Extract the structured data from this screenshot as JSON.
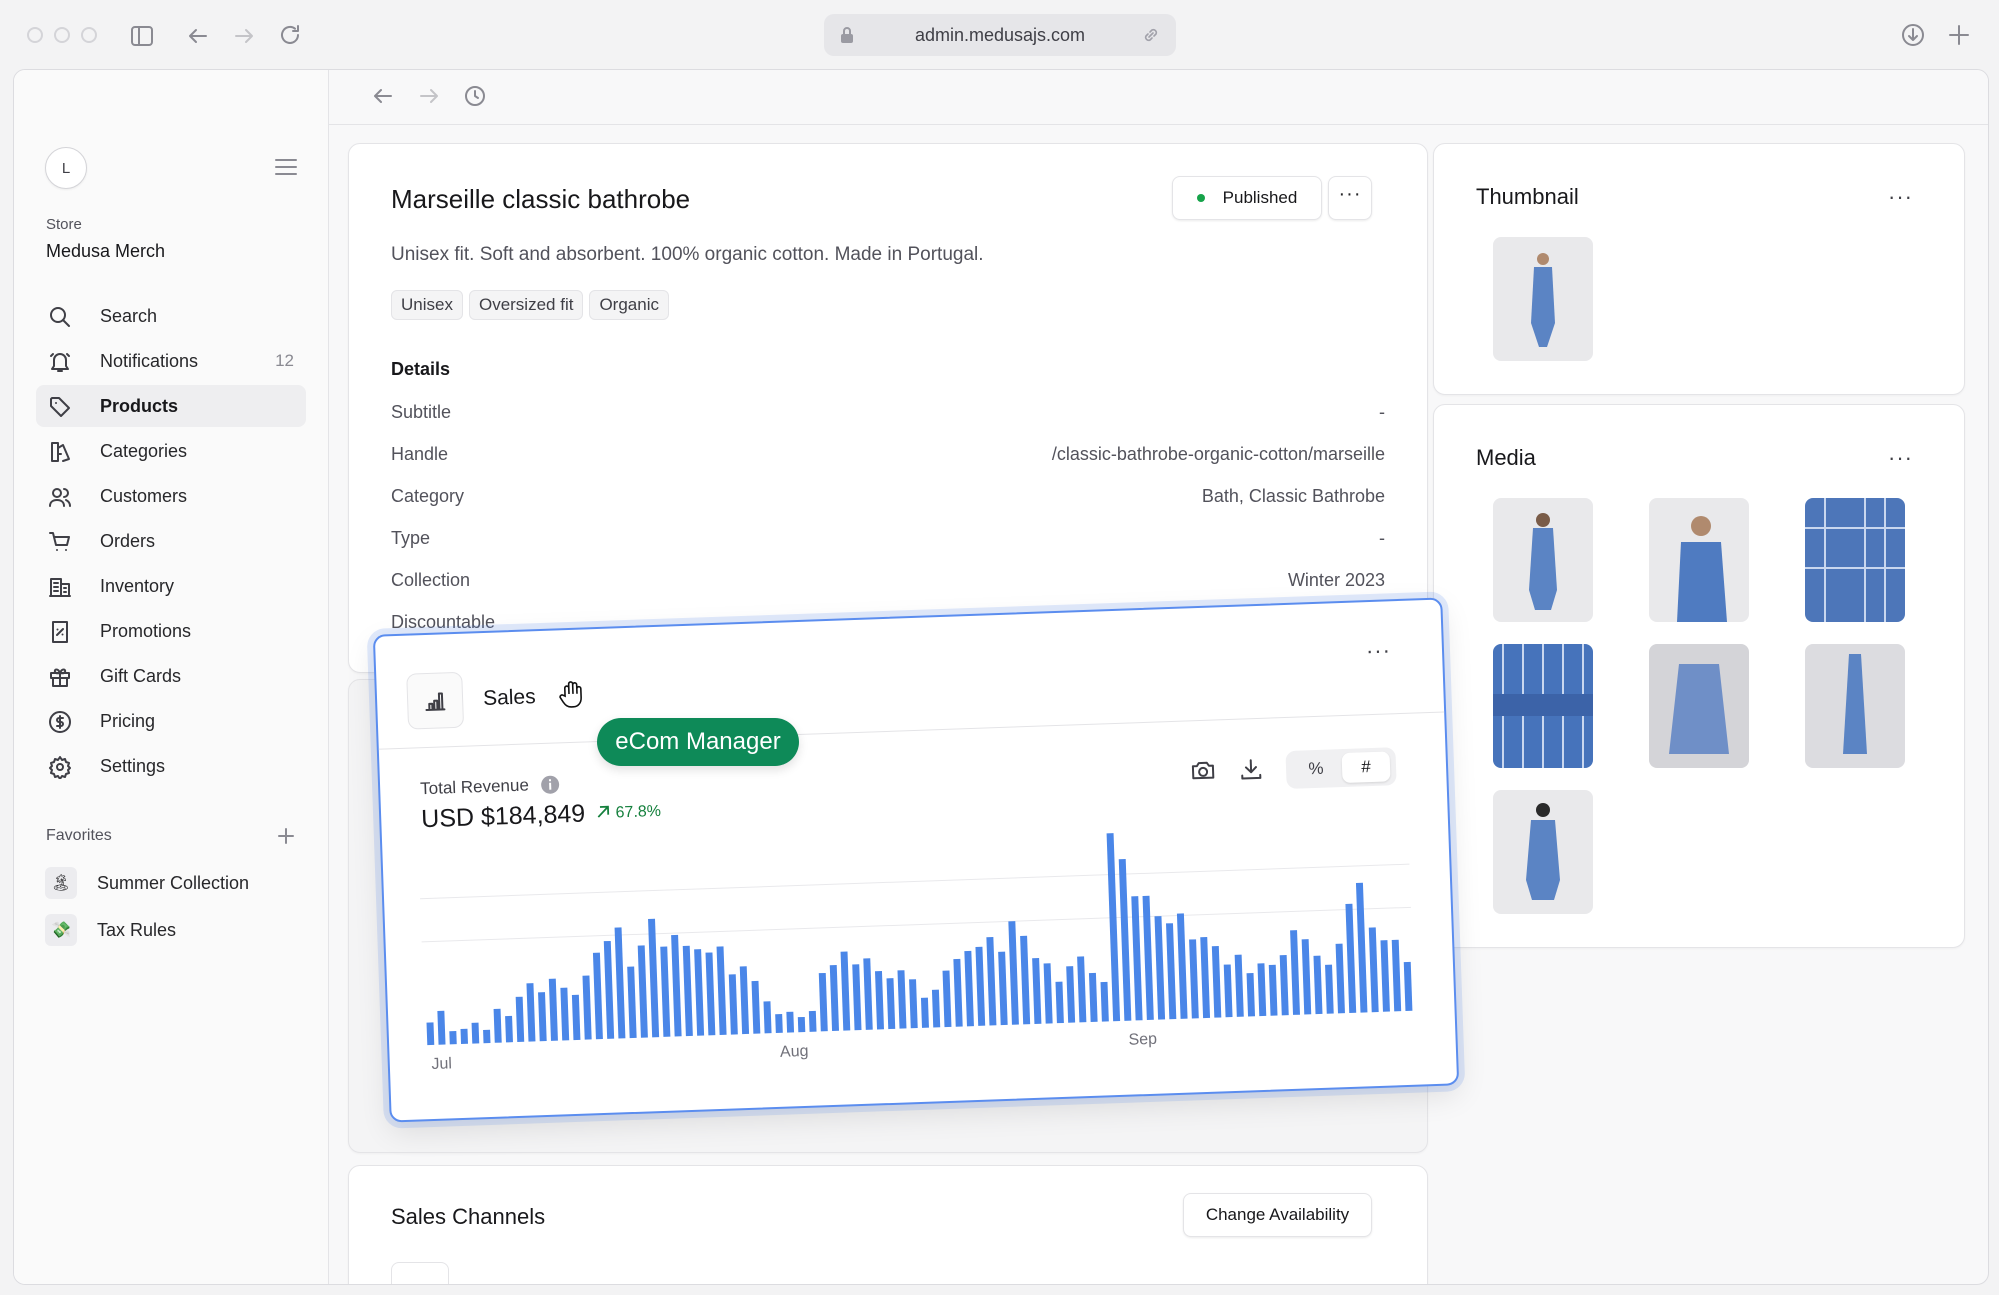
{
  "browser": {
    "url": "admin.medusajs.com"
  },
  "sidebar": {
    "avatar_initial": "L",
    "store_label": "Store",
    "store_name": "Medusa Merch",
    "items": [
      {
        "label": "Search",
        "icon": "search-icon"
      },
      {
        "label": "Notifications",
        "icon": "bell-icon",
        "count": "12"
      },
      {
        "label": "Products",
        "icon": "tag-icon",
        "active": true
      },
      {
        "label": "Categories",
        "icon": "categories-icon"
      },
      {
        "label": "Customers",
        "icon": "users-icon"
      },
      {
        "label": "Orders",
        "icon": "cart-icon"
      },
      {
        "label": "Inventory",
        "icon": "building-icon"
      },
      {
        "label": "Promotions",
        "icon": "receipt-percent-icon"
      },
      {
        "label": "Gift Cards",
        "icon": "gift-icon"
      },
      {
        "label": "Pricing",
        "icon": "currency-icon"
      },
      {
        "label": "Settings",
        "icon": "gear-icon"
      }
    ],
    "favorites_label": "Favorites",
    "favorites": [
      {
        "label": "Summer Collection",
        "icon": "palm-tree-icon"
      },
      {
        "label": "Tax Rules",
        "icon": "money-icon"
      }
    ]
  },
  "product": {
    "title": "Marseille classic bathrobe",
    "status": "Published",
    "status_color": "#16a34a",
    "description": "Unisex fit. Soft and absorbent. 100% organic cotton. Made in Portugal.",
    "tags": [
      "Unisex",
      "Oversized fit",
      "Organic"
    ],
    "details_heading": "Details",
    "details": [
      {
        "key": "Subtitle",
        "value": "-"
      },
      {
        "key": "Handle",
        "value": "/classic-bathrobe-organic-cotton/marseille"
      },
      {
        "key": "Category",
        "value": "Bath, Classic Bathrobe"
      },
      {
        "key": "Type",
        "value": "-"
      },
      {
        "key": "Collection",
        "value": "Winter 2023"
      },
      {
        "key": "Discountable",
        "value": ""
      }
    ]
  },
  "thumbnail": {
    "heading": "Thumbnail"
  },
  "media": {
    "heading": "Media",
    "count": 7
  },
  "sales_channels": {
    "heading": "Sales Channels",
    "button": "Change Availability"
  },
  "sales_widget": {
    "title": "Sales",
    "user_badge": "eCom Manager",
    "metric_label": "Total Revenue",
    "metric_value": "USD $184,849",
    "metric_change": "67.8%",
    "change_color": "#15803d",
    "toggle_percent": "%",
    "toggle_number": "#",
    "bar_color": "#4a86e8"
  },
  "chart_data": {
    "type": "bar",
    "title": "",
    "xlabel": "",
    "ylabel": "",
    "x_tick_labels": [
      "Jul",
      "Aug",
      "Sep"
    ],
    "x_tick_indices": [
      0,
      31,
      62
    ],
    "grid": true,
    "legend": "none",
    "values": [
      12,
      18,
      7,
      8,
      11,
      7,
      18,
      14,
      24,
      31,
      26,
      33,
      28,
      24,
      34,
      46,
      52,
      59,
      38,
      49,
      63,
      48,
      54,
      48,
      46,
      44,
      47,
      32,
      36,
      28,
      17,
      10,
      11,
      8,
      11,
      31,
      35,
      42,
      35,
      38,
      31,
      27,
      31,
      26,
      16,
      20,
      30,
      36,
      40,
      42,
      47,
      39,
      55,
      47,
      35,
      32,
      22,
      30,
      35,
      26,
      21,
      100,
      86,
      66,
      66,
      55,
      51,
      56,
      42,
      43,
      38,
      28,
      33,
      23,
      28,
      27,
      32,
      45,
      40,
      31,
      26,
      37,
      58,
      69,
      45,
      38,
      38,
      26
    ]
  }
}
